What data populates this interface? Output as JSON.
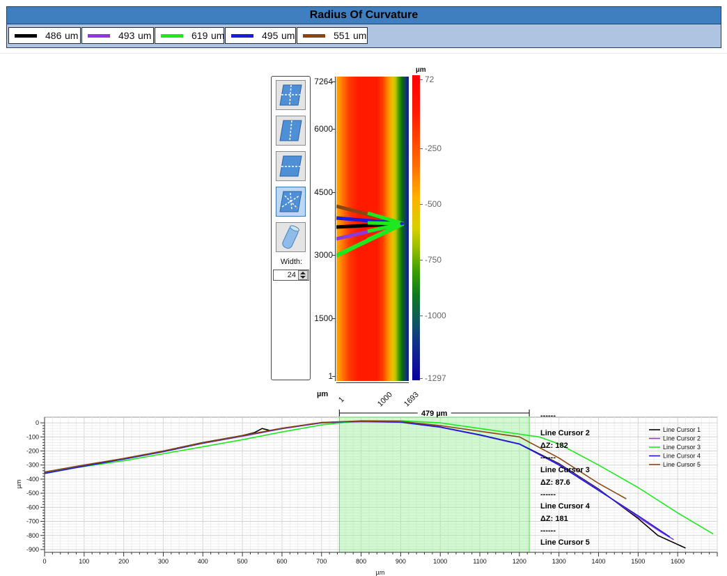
{
  "window": {
    "title": "Radius Of Curvature"
  },
  "roc_legend": [
    {
      "value": "486",
      "unit": "um",
      "color": "#000000"
    },
    {
      "value": "493",
      "unit": "um",
      "color": "#8a3adf"
    },
    {
      "value": "619",
      "unit": "um",
      "color": "#1ee81e"
    },
    {
      "value": "495",
      "unit": "um",
      "color": "#1a1ae0"
    },
    {
      "value": "551",
      "unit": "um",
      "color": "#8b4513"
    }
  ],
  "tools": {
    "buttons": [
      "cross-cursor-icon",
      "vertical-cursor-icon",
      "horizontal-cursor-icon",
      "radial-cursor-icon",
      "cylinder-icon"
    ],
    "active_index": 3,
    "width_label": "Width:",
    "width_value": "24"
  },
  "heatmap": {
    "unit": "µm",
    "y_ticks": [
      "7264",
      "6000",
      "4500",
      "3000",
      "1500",
      "1"
    ],
    "x_ticks": [
      "1",
      "1000",
      "1693"
    ],
    "colorbar_unit": "µm",
    "colorbar_ticks": [
      "72",
      "-250",
      "-500",
      "-750",
      "-1000",
      "-1297"
    ]
  },
  "chart_data": {
    "type": "line",
    "xlabel": "µm",
    "ylabel": "µm",
    "xlim": [
      0,
      1700
    ],
    "ylim": [
      -920,
      40
    ],
    "x_ticks": [
      0,
      100,
      200,
      300,
      400,
      500,
      600,
      700,
      800,
      900,
      1000,
      1100,
      1200,
      1300,
      1400,
      1500,
      1600
    ],
    "y_ticks": [
      0,
      -100,
      -200,
      -300,
      -400,
      -500,
      -600,
      -700,
      -800,
      -900
    ],
    "grid": true,
    "legend_position": "top-right",
    "selection": {
      "x_start": 745,
      "x_end": 1225,
      "label": "479 µm"
    },
    "annotations": [
      "------",
      "Line Cursor 2",
      "ΔZ: 182",
      "------",
      "Line Cursor 3",
      "ΔZ: 87.6",
      "------",
      "Line Cursor 4",
      "ΔZ: 181",
      "------",
      "Line Cursor 5"
    ],
    "series": [
      {
        "name": "Line Cursor 1",
        "color": "#000000",
        "x": [
          0,
          100,
          200,
          300,
          400,
          500,
          530,
          550,
          570,
          600,
          700,
          800,
          900,
          1000,
          1100,
          1200,
          1300,
          1400,
          1500,
          1550,
          1620
        ],
        "y": [
          -350,
          -300,
          -255,
          -200,
          -140,
          -90,
          -70,
          -40,
          -55,
          -40,
          0,
          10,
          5,
          -30,
          -85,
          -150,
          -290,
          -470,
          -680,
          -800,
          -890
        ]
      },
      {
        "name": "Line Cursor 2",
        "color": "#8a3adf",
        "x": [
          0,
          100,
          200,
          300,
          400,
          500,
          600,
          700,
          800,
          900,
          1000,
          1100,
          1200,
          1300,
          1400,
          1500,
          1560,
          1590
        ],
        "y": [
          -355,
          -305,
          -258,
          -205,
          -145,
          -95,
          -42,
          0,
          8,
          4,
          -32,
          -88,
          -152,
          -295,
          -475,
          -670,
          -780,
          -830
        ]
      },
      {
        "name": "Line Cursor 3",
        "color": "#1ee81e",
        "x": [
          0,
          100,
          200,
          300,
          400,
          500,
          600,
          700,
          800,
          900,
          1000,
          1100,
          1200,
          1250,
          1300,
          1400,
          1500,
          1600,
          1690
        ],
        "y": [
          -350,
          -310,
          -270,
          -220,
          -170,
          -120,
          -65,
          -15,
          15,
          15,
          0,
          -40,
          -80,
          -100,
          -150,
          -300,
          -460,
          -640,
          -790
        ]
      },
      {
        "name": "Line Cursor 4",
        "color": "#1a1ae0",
        "x": [
          0,
          100,
          200,
          300,
          400,
          500,
          600,
          700,
          800,
          900,
          1000,
          1100,
          1200,
          1300,
          1400,
          1500,
          1580
        ],
        "y": [
          -360,
          -308,
          -258,
          -205,
          -145,
          -92,
          -40,
          2,
          12,
          6,
          -30,
          -86,
          -150,
          -300,
          -480,
          -660,
          -810
        ]
      },
      {
        "name": "Line Cursor 5",
        "color": "#8b4513",
        "x": [
          0,
          100,
          200,
          300,
          400,
          500,
          600,
          700,
          800,
          900,
          1000,
          1100,
          1200,
          1300,
          1400,
          1470
        ],
        "y": [
          -350,
          -300,
          -253,
          -200,
          -142,
          -90,
          -38,
          3,
          14,
          10,
          -20,
          -60,
          -100,
          -250,
          -430,
          -540
        ]
      }
    ]
  }
}
